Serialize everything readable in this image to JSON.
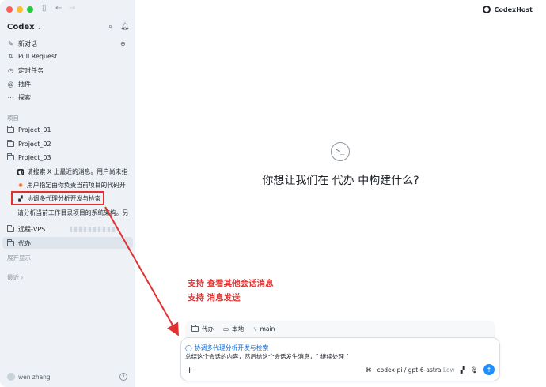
{
  "window": {
    "toolbar_icons": [
      "sidebar-toggle-icon",
      "back-arrow-icon",
      "forward-arrow-icon"
    ]
  },
  "sidebar": {
    "app_title": "Codex",
    "nav": [
      {
        "label": "新对话",
        "icon": "compose-icon"
      },
      {
        "label": "Pull Request",
        "icon": "pull-request-icon"
      },
      {
        "label": "定时任务",
        "icon": "clock-icon"
      },
      {
        "label": "插件",
        "icon": "plugin-icon"
      },
      {
        "label": "探索",
        "icon": "ellipsis-icon"
      }
    ],
    "projects_label": "项目",
    "projects": [
      {
        "label": "Project_01"
      },
      {
        "label": "Project_02"
      },
      {
        "label": "Project_03"
      }
    ],
    "threads": [
      {
        "label": "请搜索 X 上最近的消息。用户尚未指"
      },
      {
        "label": "用户指定由你负责当前项目的代码开"
      },
      {
        "label": "协调多代理分析开发与检索"
      },
      {
        "label": "请分析当前工作目录项目的系统架构。另"
      }
    ],
    "remote": {
      "label": "远程-VPS"
    },
    "active_project": {
      "label": "代办"
    },
    "expand_label": "展开显示",
    "recent_label": "最近",
    "user_name": "wen zhang",
    "help_label": "?"
  },
  "main": {
    "host_name": "CodexHost",
    "headline": "你想让我们在 代办 中构建什么?",
    "annotations": [
      "支持 查看其他会话消息",
      "支持 消息发送"
    ],
    "context": {
      "folder": "代办",
      "location": "本地",
      "branch": "main"
    },
    "composer": {
      "mention": "协调多代理分析开发与检索",
      "text": "总结这个会话的内容，然后给这个会话发生消息，\" 继续处理 \"",
      "model": "codex-pi / gpt-6-astra",
      "effort": "Low"
    }
  },
  "colors": {
    "annotation": "#e03131",
    "sidebar_bg": "#eef2f6",
    "send_button": "#1f8fff",
    "link": "#0969da"
  }
}
